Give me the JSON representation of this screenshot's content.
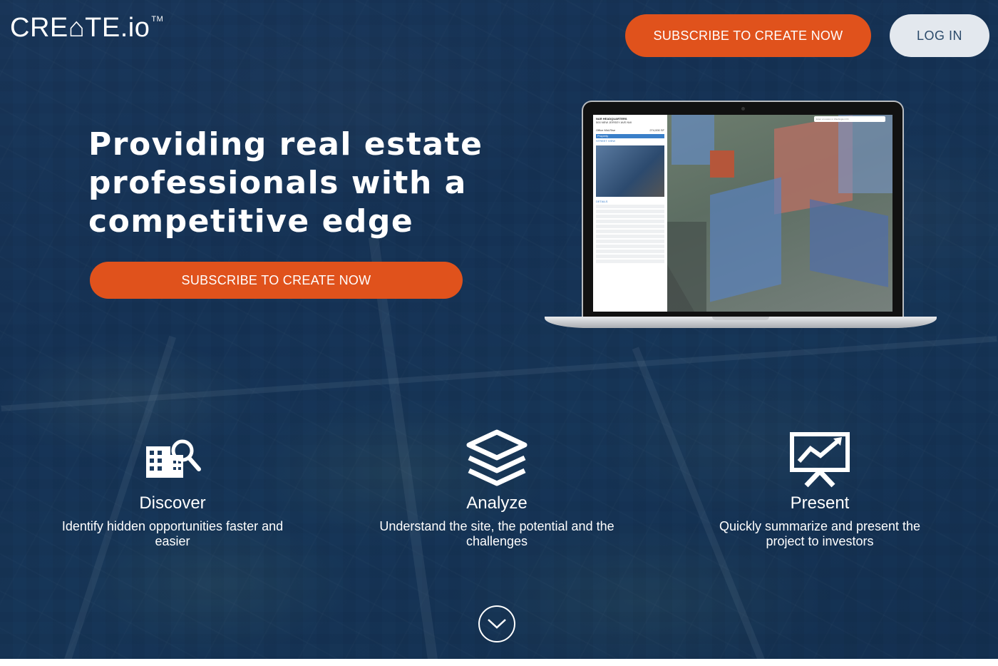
{
  "header": {
    "logo_text": "CRE⌂TE.io",
    "logo_tm": "TM",
    "subscribe_label": "SUBSCRIBE TO CREATE NOW",
    "login_label": "LOG IN"
  },
  "hero": {
    "title": "Providing real estate professionals with a competitive edge",
    "cta_label": "SUBSCRIBE TO CREATE NOW"
  },
  "laptop_screen": {
    "panel_title": "NAR HEADQUARTERS",
    "panel_address": "500 NEW JERSEY AVE NW",
    "panel_type": "Office Mid-Rise",
    "panel_size": "274,000 SF",
    "tab_property": "Property",
    "tab_street_view": "STREET VIEW",
    "section_details": "DETAILS",
    "search_placeholder": "Enter a location in Washington DC"
  },
  "features": [
    {
      "icon": "building-search-icon",
      "title": "Discover",
      "text": "Identify hidden opportunities faster and easier"
    },
    {
      "icon": "layers-icon",
      "title": "Analyze",
      "text": "Understand the site, the potential and the challenges"
    },
    {
      "icon": "presentation-chart-icon",
      "title": "Present",
      "text": "Quickly summarize and present the project to investors"
    }
  ],
  "colors": {
    "accent": "#e0521c",
    "background": "#15304f",
    "login_bg": "#e3e8ee",
    "login_text": "#2b4a6a"
  },
  "scroll_icon": "chevron-down-icon"
}
